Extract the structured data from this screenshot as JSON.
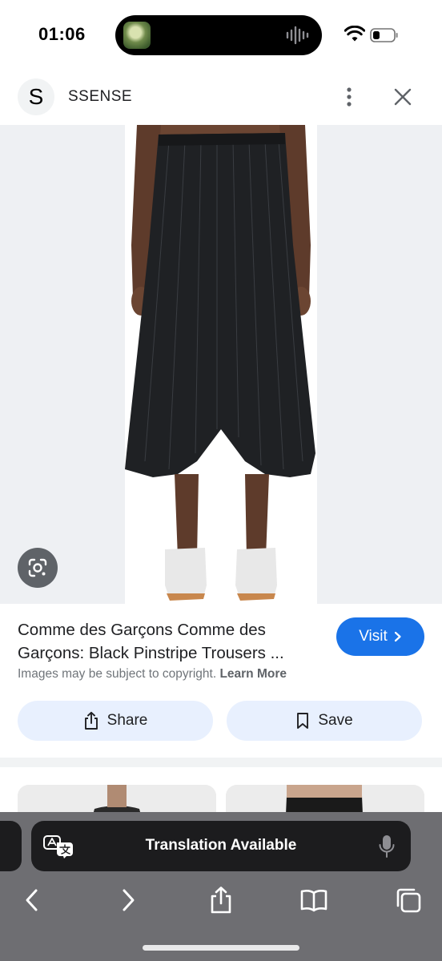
{
  "status_bar": {
    "time": "01:06"
  },
  "site": {
    "avatar_letter": "S",
    "name": "SSENSE"
  },
  "product": {
    "title": "Comme des Garçons Comme des Garçons: Black Pinstripe Trousers ...",
    "copyright_text": "Images may be subject to copyright.",
    "learn_more": "Learn More"
  },
  "actions": {
    "visit_label": "Visit",
    "share_label": "Share",
    "save_label": "Save"
  },
  "safari": {
    "translation_text": "Translation Available"
  },
  "colors": {
    "accent": "#1a73e8",
    "button_tint": "#e8f0fe",
    "toolbar_bg": "#6e6e72"
  },
  "icons": {
    "island": [
      "album-art-icon",
      "audio-waveform-icon"
    ],
    "status": [
      "wifi-icon",
      "battery-icon"
    ],
    "header": [
      "more-vert-icon",
      "close-icon"
    ],
    "image": [
      "lens-icon"
    ],
    "actions": [
      "chevron-right-icon",
      "share-icon",
      "bookmark-icon"
    ],
    "toolbar": [
      "back-icon",
      "forward-icon",
      "share-icon",
      "bookmarks-icon",
      "tabs-icon"
    ],
    "translation": [
      "translate-icon",
      "mic-icon"
    ]
  }
}
